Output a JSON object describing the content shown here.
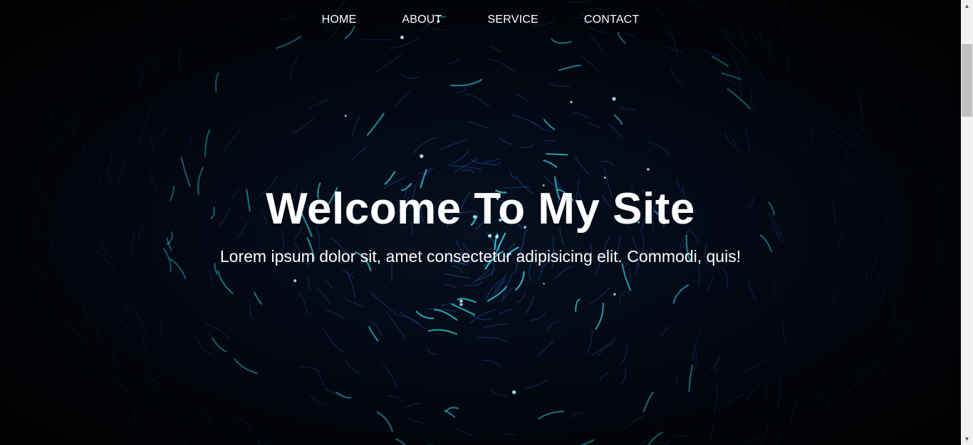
{
  "nav": {
    "items": [
      {
        "label": "HOME"
      },
      {
        "label": "ABOUT"
      },
      {
        "label": "SERVICE"
      },
      {
        "label": "CONTACT"
      }
    ]
  },
  "hero": {
    "title": "Welcome To My Site",
    "subtitle": "Lorem ipsum dolor sit, amet consectetur adipisicing elit. Commodi, quis!",
    "background": "dark night sky with blue and cyan light trails"
  },
  "colors": {
    "text": "#ffffff",
    "background": "#000000",
    "trail_blue": "#1f4fa8",
    "trail_cyan": "#2fd4e8"
  },
  "scrollbar": {
    "up_icon": "triangle-up",
    "down_icon": "triangle-down"
  }
}
